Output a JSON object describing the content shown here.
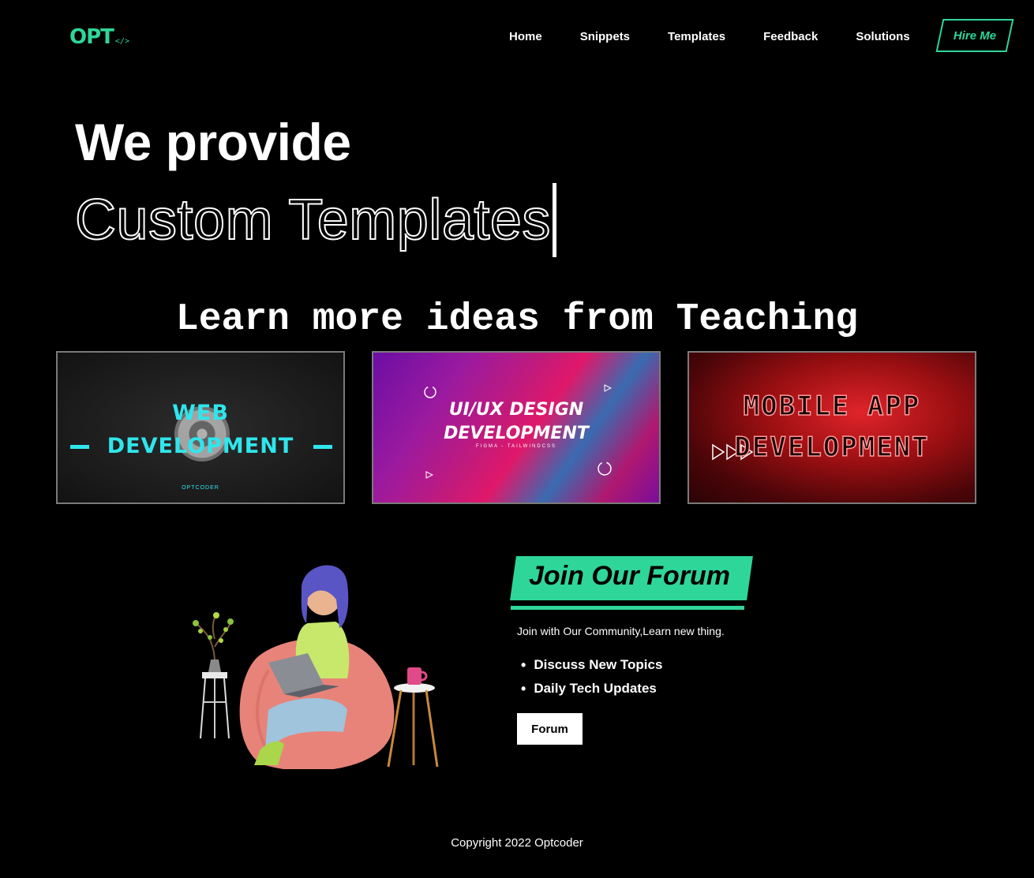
{
  "nav": {
    "logo_main": "OPT",
    "logo_tag": "</>",
    "items": [
      {
        "label": "Home"
      },
      {
        "label": "Snippets"
      },
      {
        "label": "Templates"
      },
      {
        "label": "Feedback"
      },
      {
        "label": "Solutions"
      }
    ],
    "hire_label": "Hire Me"
  },
  "hero": {
    "line1": "We provide",
    "line2": "Custom Templates"
  },
  "section_title": "Learn more ideas from Teaching",
  "cards": [
    {
      "title_l1": "WEB",
      "title_l2": "DEVELOPMENT",
      "subtitle": "OPTCODER"
    },
    {
      "title_l1": "UI/UX DESIGN",
      "title_l2": "DEVELOPMENT",
      "subtitle": "FIGMA - TAILWINDCSS"
    },
    {
      "title_l1": "MOBILE APP",
      "title_l2": "DEVELOPMENT"
    }
  ],
  "forum": {
    "title": "Join Our Forum",
    "description": "Join with Our Community,Learn new thing.",
    "items": [
      "Discuss New Topics",
      "Daily Tech Updates"
    ],
    "button_label": "Forum"
  },
  "footer": {
    "copyright": "Copyright 2022 Optcoder"
  },
  "colors": {
    "accent": "#2fd69a",
    "background": "#000000",
    "card_cyan": "#2fe6ec"
  }
}
